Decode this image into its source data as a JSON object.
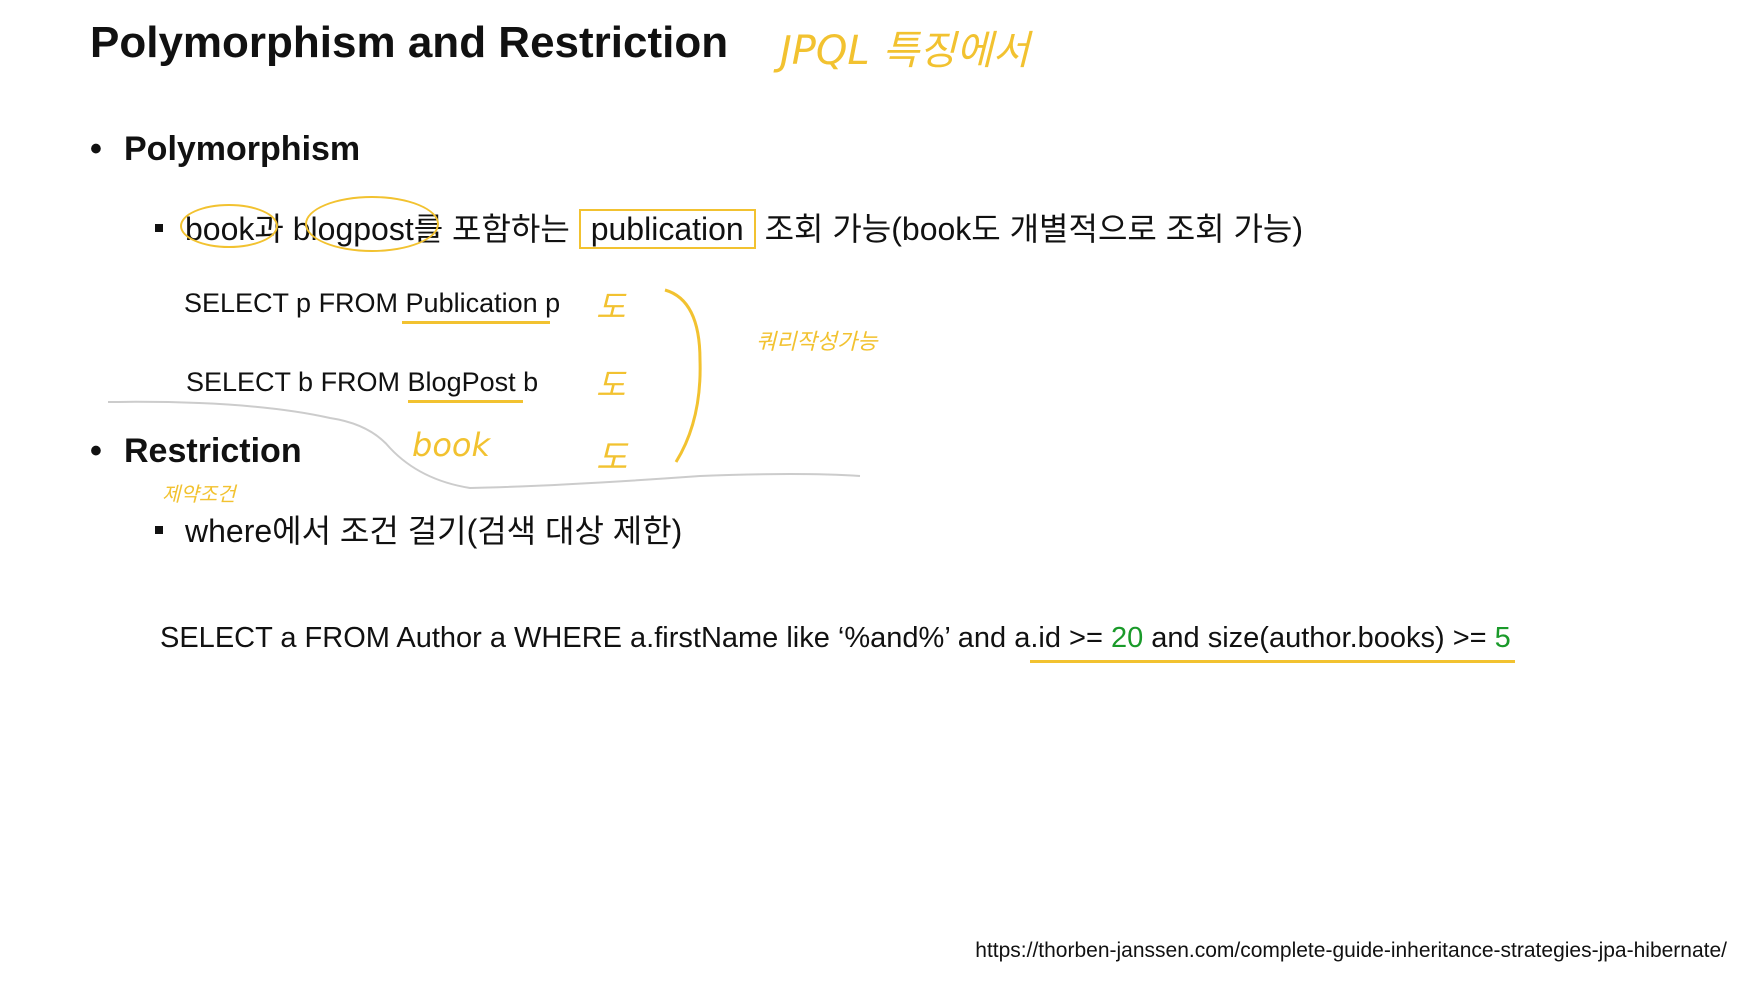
{
  "title": "Polymorphism and Restriction",
  "title_note": "JPQL 특징에서",
  "polymorphism": {
    "heading": "Polymorphism",
    "line": {
      "w1": "book",
      "t1": "과 ",
      "w2": "blogpost",
      "t2": "를 포함하는 ",
      "w3": "publication",
      "t3": " 조회 가능(book도 개별적으로 조회 가능)"
    },
    "queries": [
      "SELECT p FROM Publication p",
      "SELECT b FROM BlogPost b"
    ],
    "notes": {
      "do": "도",
      "book": "book",
      "query": "쿼리작성가능"
    }
  },
  "restriction": {
    "heading": "Restriction",
    "note": "제약조건",
    "line": "where에서 조건 걸기(검색 대상 제한)",
    "query": {
      "p1": "SELECT a FROM Author a WHERE a.firstName like ‘%and%’ and a.id >= ",
      "n1": "20",
      "p2": " and size(author.books) >= ",
      "n2": "5"
    }
  },
  "source_url": "https://thorben-janssen.com/complete-guide-inheritance-strategies-jpa-hibernate/",
  "colors": {
    "highlight": "#f2c230",
    "number": "#1a9a2a"
  }
}
